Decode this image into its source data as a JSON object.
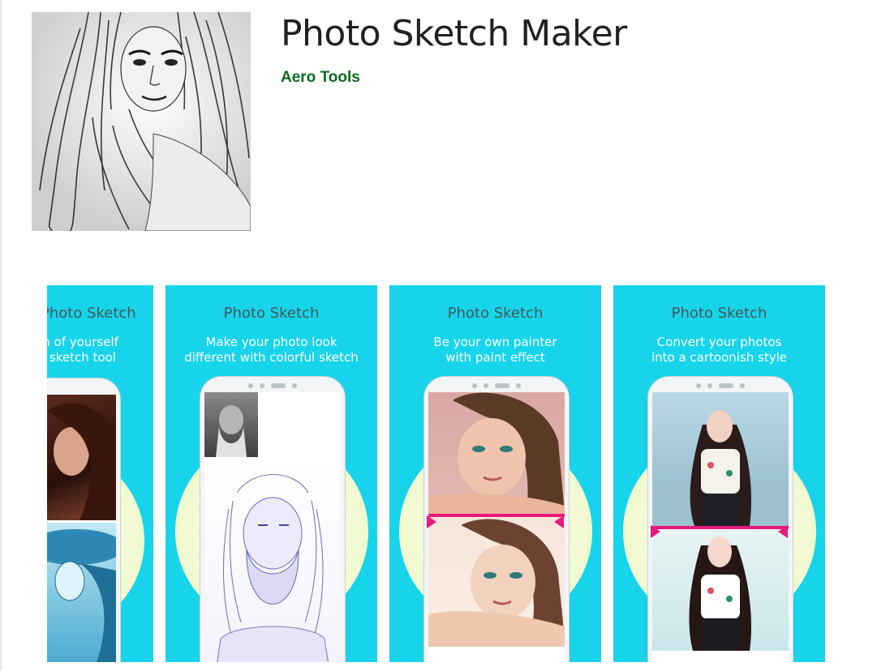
{
  "app": {
    "title": "Photo Sketch Maker",
    "developer": "Aero Tools"
  },
  "colors": {
    "card_bg": "#17d4ea",
    "developer_green": "#0b6b1f",
    "divider_pink": "#e8197c"
  },
  "icons": {
    "app_icon": "sketch-portrait-icon"
  },
  "screenshots": [
    {
      "title": "Photo Sketch",
      "line1": "ch of yourself",
      "line2": "l sketch tool"
    },
    {
      "title": "Photo Sketch",
      "line1": "Make your photo look",
      "line2": "different with colorful sketch"
    },
    {
      "title": "Photo Sketch",
      "line1": "Be your own painter",
      "line2": "with paint effect"
    },
    {
      "title": "Photo Sketch",
      "line1": "Convert your photos",
      "line2": "into a cartoonish style"
    }
  ]
}
